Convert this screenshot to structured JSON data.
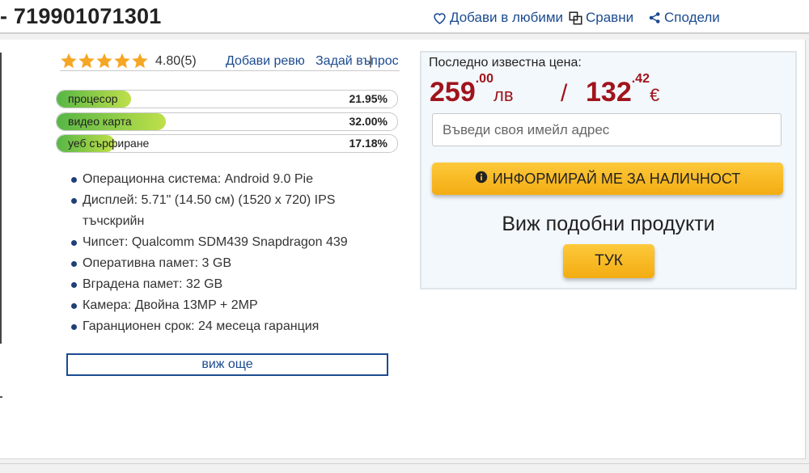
{
  "header": {
    "title": "- 719901071301",
    "favorites_label": "Добави в любими",
    "compare_label": "Сравни",
    "share_label": "Сподели"
  },
  "rating": {
    "stars": 5,
    "value": "4.80(5)",
    "add_review": "Добави ревю",
    "separator": "|",
    "ask_question": "Задай въпрос"
  },
  "performance": [
    {
      "label": "процесор",
      "percent": "21.95%",
      "fill": 0.2195
    },
    {
      "label": "видео карта",
      "percent": "32.00%",
      "fill": 0.32
    },
    {
      "label": "уеб сърфиране",
      "percent": "17.18%",
      "fill": 0.1718
    }
  ],
  "specs": [
    "Операционна система: Android 9.0 Pie",
    "Дисплей: 5.71\" (14.50 см) (1520 x 720) IPS тъчскрийн",
    "Чипсет: Qualcomm SDM439 Snapdragon 439",
    "Оперативна памет: 3 GB",
    "Вградена памет: 32 GB",
    "Камера: Двойна 13MP + 2MP",
    "Гаранционен срок: 24 месеца гаранция"
  ],
  "more_label": "виж още",
  "price_box": {
    "last_price_label": "Последно известна цена:",
    "bgn_main": "259",
    "bgn_cents": ".00",
    "bgn_currency": "лв",
    "separator": "/",
    "eur_main": "132",
    "eur_cents": ".42",
    "eur_currency": "€",
    "email_placeholder": "Въведи своя имейл адрес",
    "notify_label": "ИНФОРМИРАЙ МЕ ЗА НАЛИЧНОСТ",
    "similar_label": "Виж подобни продукти",
    "here_label": "ТУК"
  },
  "colors": {
    "link": "#1b4b91",
    "price": "#a0141b",
    "button": "#f7b52a",
    "star": "#f5a623"
  }
}
